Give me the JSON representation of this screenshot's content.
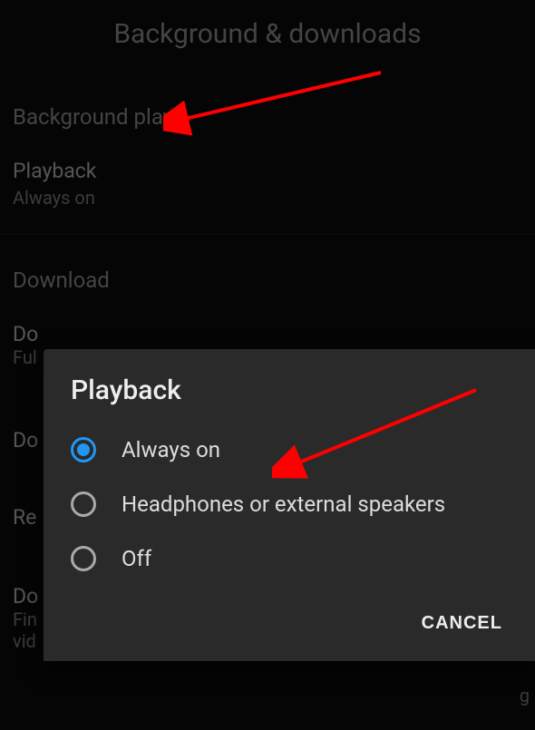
{
  "header": {
    "title": "Background & downloads"
  },
  "sections": {
    "background_play": {
      "header": "Background play",
      "playback": {
        "label": "Playback",
        "value": "Always on"
      }
    },
    "download": {
      "header": "Download",
      "item1_label_prefix": "Do",
      "item1_value_prefix": "Ful",
      "item2_label_prefix": "Do",
      "item3_label_prefix": "Re",
      "item4_label_prefix": "Do",
      "item4_value_line1": "Fin",
      "item4_value_line2": "vid",
      "item4_value_suffix": "g"
    }
  },
  "dialog": {
    "title": "Playback",
    "options": [
      {
        "label": "Always on",
        "selected": true
      },
      {
        "label": "Headphones or external speakers",
        "selected": false
      },
      {
        "label": "Off",
        "selected": false
      }
    ],
    "cancel": "CANCEL"
  }
}
